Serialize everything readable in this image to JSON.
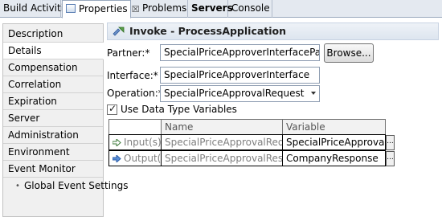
{
  "tabs": [
    {
      "label": "Build Activities"
    },
    {
      "label": "Properties",
      "close": "☒"
    },
    {
      "label": "Problems"
    },
    {
      "label": "Servers"
    },
    {
      "label": "Console"
    }
  ],
  "sidebar": {
    "items": [
      {
        "label": "Description"
      },
      {
        "label": "Details"
      },
      {
        "label": "Compensation"
      },
      {
        "label": "Correlation"
      },
      {
        "label": "Expiration"
      },
      {
        "label": "Server"
      },
      {
        "label": "Administration"
      },
      {
        "label": "Environment"
      },
      {
        "label": "Event Monitor"
      },
      {
        "label": "Global Event Settings"
      }
    ],
    "selected": "Details"
  },
  "header": {
    "title": "Invoke - ProcessApplication",
    "icon": "invoke-icon"
  },
  "form": {
    "partner_label": "Partner:*",
    "partner_value": "SpecialPriceApproverInterfacePartner",
    "browse_label": "Browse...",
    "interface_label": "Interface:*",
    "interface_value": "SpecialPriceApproverInterface",
    "operation_label": "Operation:*",
    "operation_value": "SpecialPriceApprovalRequest",
    "use_data_types_label": "Use Data Type Variables",
    "use_data_types_checked": true
  },
  "table": {
    "headers": [
      "Name",
      "Variable"
    ],
    "rows": [
      {
        "kind": "Input(s)",
        "name": "SpecialPriceApprovalRequest",
        "variable": "SpecialPriceApprovalData",
        "button": "..."
      },
      {
        "kind": "Output(s)",
        "name": "SpecialPriceApprovalResponse",
        "variable": "CompanyResponse",
        "button": "..."
      }
    ]
  },
  "colors": {
    "tab_bar": "#e4e9f0",
    "sidebar_bg": "#f0f0f0",
    "header_bg": "#dde5ef"
  }
}
